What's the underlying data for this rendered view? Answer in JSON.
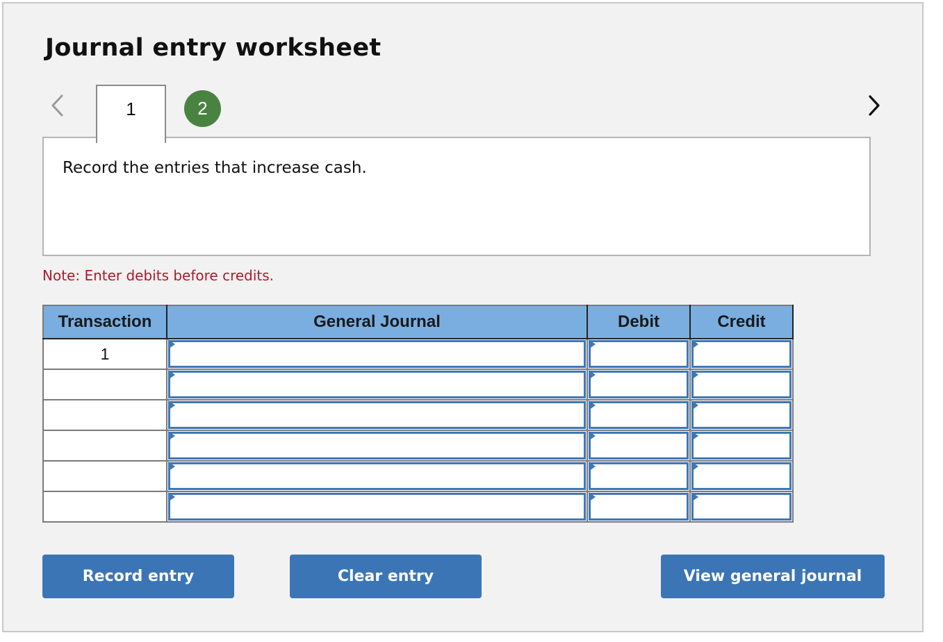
{
  "header": {
    "title": "Journal entry worksheet"
  },
  "navigation": {
    "prev_icon": "chevron-left-icon",
    "next_icon": "chevron-right-icon",
    "tabs": [
      {
        "label": "1",
        "state": "active"
      },
      {
        "label": "2",
        "state": "completed",
        "color": "#4a8341"
      }
    ]
  },
  "prompt": {
    "text": "Record the entries that increase cash."
  },
  "note": {
    "text": "Note: Enter debits before credits.",
    "color": "#b0182a"
  },
  "journal": {
    "columns": [
      "Transaction",
      "General Journal",
      "Debit",
      "Credit"
    ],
    "header_color": "#7aaee0",
    "rows": [
      {
        "transaction": "1",
        "account": "",
        "debit": "",
        "credit": ""
      },
      {
        "transaction": "",
        "account": "",
        "debit": "",
        "credit": ""
      },
      {
        "transaction": "",
        "account": "",
        "debit": "",
        "credit": ""
      },
      {
        "transaction": "",
        "account": "",
        "debit": "",
        "credit": ""
      },
      {
        "transaction": "",
        "account": "",
        "debit": "",
        "credit": ""
      },
      {
        "transaction": "",
        "account": "",
        "debit": "",
        "credit": ""
      }
    ]
  },
  "buttons": {
    "record": "Record entry",
    "clear": "Clear entry",
    "view": "View general journal",
    "color": "#3c75b5"
  }
}
